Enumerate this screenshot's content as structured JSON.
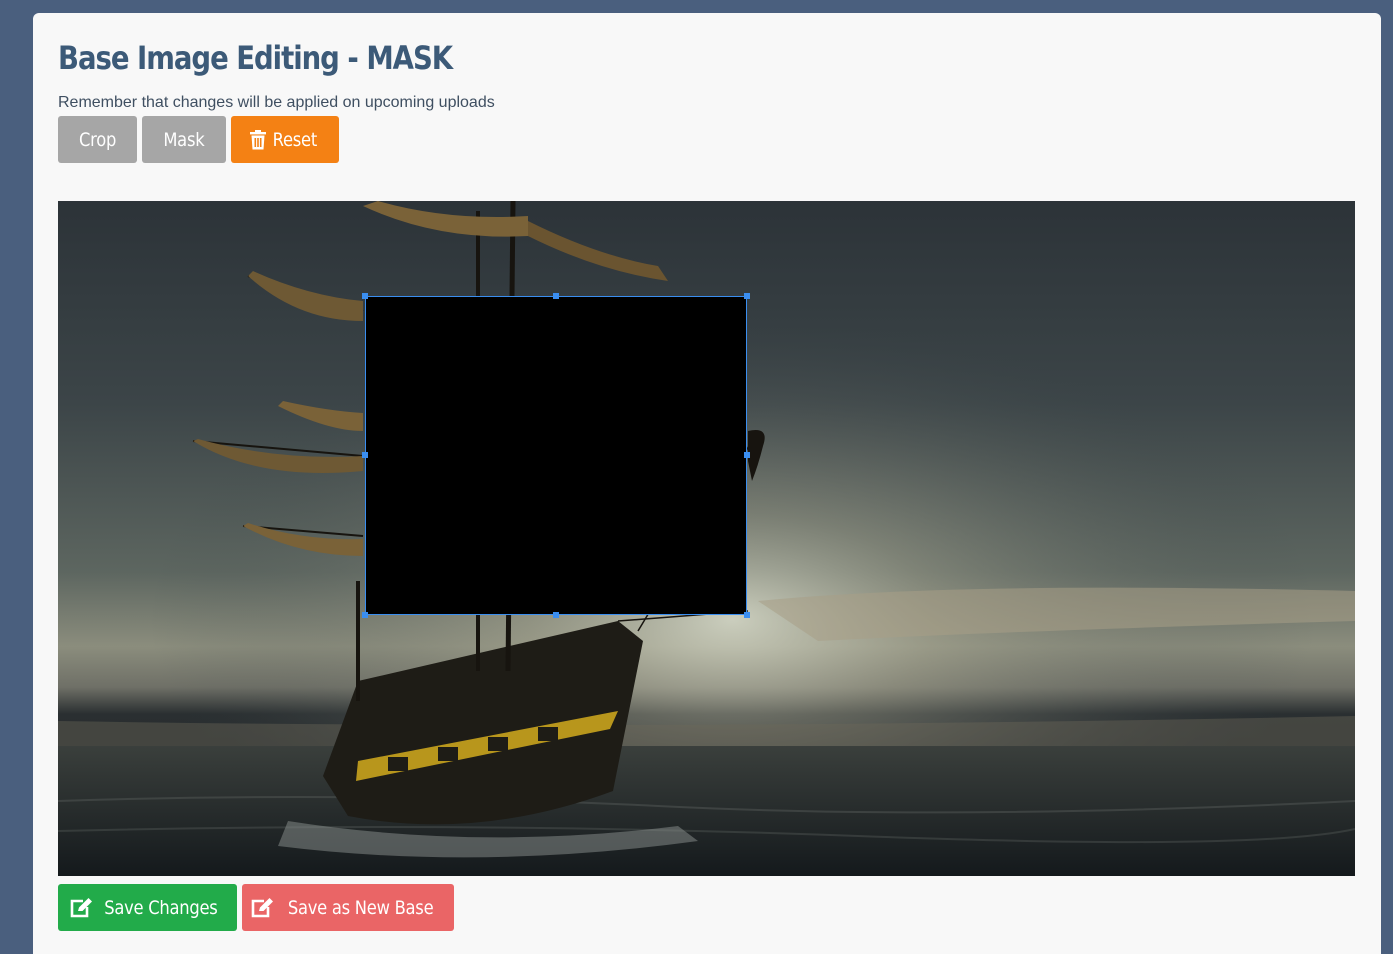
{
  "page": {
    "title": "Base Image Editing - MASK",
    "subtitle": "Remember that changes will be applied on upcoming uploads"
  },
  "toolbar": {
    "crop_label": "Crop",
    "mask_label": "Mask",
    "reset_label": "Reset",
    "reset_icon": "trash-icon"
  },
  "editor": {
    "image_subject": "tall ship sailing at sunset",
    "mask_mode": "rectangle",
    "mask_color": "#000000",
    "selection_color": "#3a8ef0"
  },
  "actions": {
    "save_label": "Save Changes",
    "save_as_new_label": "Save as New Base",
    "edit_icon": "edit-icon"
  },
  "colors": {
    "background": "#4a5f7e",
    "panel": "#f8f8f8",
    "title": "#3c5a78",
    "neutral_button": "#a6a6a6",
    "reset_button": "#f48114",
    "save_button": "#22ab4a",
    "save_as_new_button": "#ea6566"
  }
}
